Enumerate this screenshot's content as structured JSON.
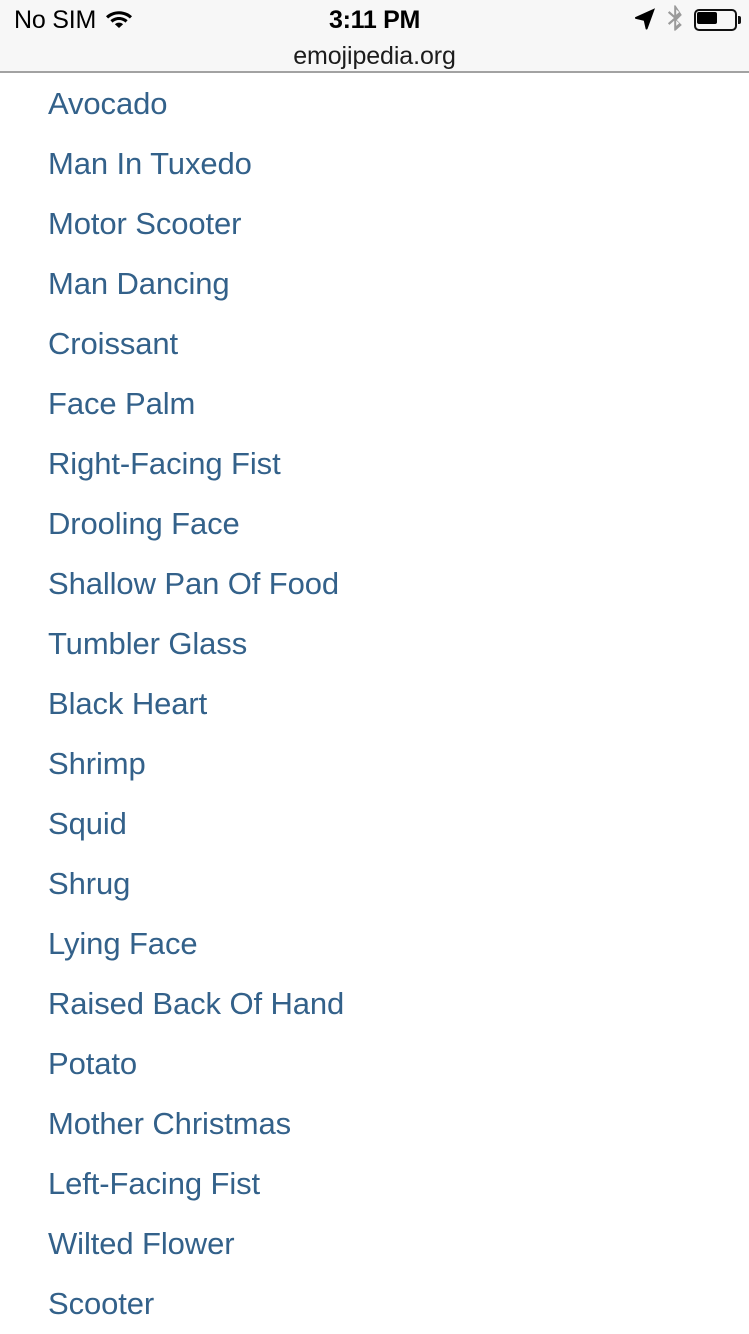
{
  "status_bar": {
    "carrier": "No SIM",
    "wifi_icon": "wifi-icon",
    "time": "3:11 PM",
    "location_icon": "location-arrow-icon",
    "bluetooth_icon": "bluetooth-icon",
    "bluetooth_color": "#9a9a9a",
    "battery_icon": "battery-icon",
    "battery_level_percent": 55
  },
  "browser": {
    "url": "emojipedia.org",
    "chrome_background": "#f7f7f7",
    "chrome_border": "#a2a2a2"
  },
  "page": {
    "link_color": "#33618a",
    "background": "#ffffff",
    "links": [
      {
        "label": "Avocado"
      },
      {
        "label": "Man In Tuxedo"
      },
      {
        "label": "Motor Scooter"
      },
      {
        "label": "Man Dancing"
      },
      {
        "label": "Croissant"
      },
      {
        "label": "Face Palm"
      },
      {
        "label": "Right-Facing Fist"
      },
      {
        "label": "Drooling Face"
      },
      {
        "label": "Shallow Pan Of Food"
      },
      {
        "label": "Tumbler Glass"
      },
      {
        "label": "Black Heart"
      },
      {
        "label": "Shrimp"
      },
      {
        "label": "Squid"
      },
      {
        "label": "Shrug"
      },
      {
        "label": "Lying Face"
      },
      {
        "label": "Raised Back Of Hand"
      },
      {
        "label": "Potato"
      },
      {
        "label": "Mother Christmas"
      },
      {
        "label": "Left-Facing Fist"
      },
      {
        "label": "Wilted Flower"
      },
      {
        "label": "Scooter"
      }
    ]
  }
}
